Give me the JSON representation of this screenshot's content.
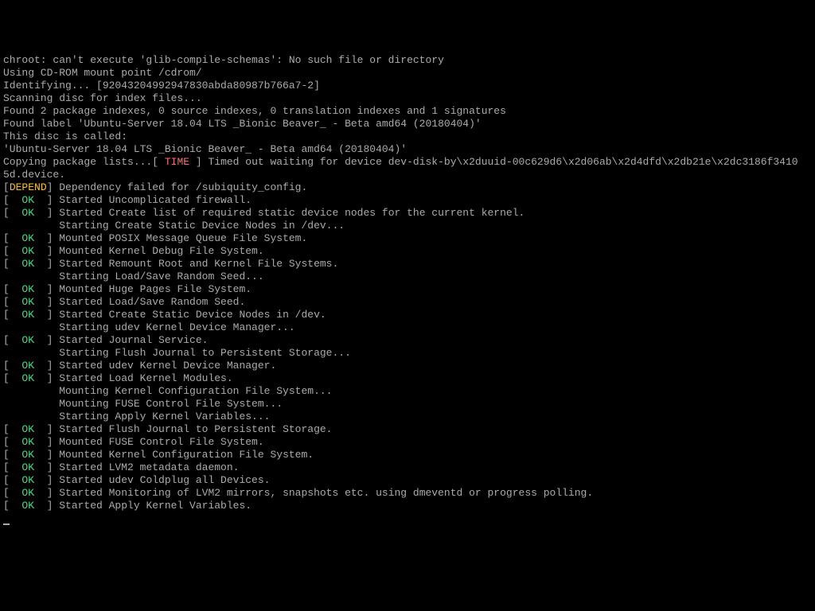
{
  "lines": [
    {
      "segments": [
        {
          "text": "chroot: can't execute 'glib-compile-schemas': No such file or directory",
          "class": "white"
        }
      ]
    },
    {
      "segments": [
        {
          "text": "Using CD-ROM mount point /cdrom/",
          "class": "white"
        }
      ]
    },
    {
      "segments": [
        {
          "text": "Identifying... [92043204992947830abda80987b766a7-2]",
          "class": "white"
        }
      ]
    },
    {
      "segments": [
        {
          "text": "Scanning disc for index files...",
          "class": "white"
        }
      ]
    },
    {
      "segments": [
        {
          "text": "Found 2 package indexes, 0 source indexes, 0 translation indexes and 1 signatures",
          "class": "white"
        }
      ]
    },
    {
      "segments": [
        {
          "text": "Found label 'Ubuntu-Server 18.04 LTS _Bionic Beaver_ - Beta amd64 (20180404)'",
          "class": "white"
        }
      ]
    },
    {
      "segments": [
        {
          "text": "This disc is called:",
          "class": "white"
        }
      ]
    },
    {
      "segments": [
        {
          "text": "'Ubuntu-Server 18.04 LTS _Bionic Beaver_ - Beta amd64 (20180404)'",
          "class": "white"
        }
      ]
    },
    {
      "segments": [
        {
          "text": "Copying package lists...[ ",
          "class": "white"
        },
        {
          "text": "TIME",
          "class": "red"
        },
        {
          "text": " ] Timed out waiting for device dev-disk-by\\x2duuid-00c629d6\\x2d06ab\\x2d4dfd\\x2db21e\\x2dc3186f3410",
          "class": "white"
        }
      ]
    },
    {
      "segments": [
        {
          "text": "5d.device.",
          "class": "white"
        }
      ]
    },
    {
      "segments": [
        {
          "text": "[",
          "class": "white"
        },
        {
          "text": "DEPEND",
          "class": "yellow"
        },
        {
          "text": "] Dependency failed for /subiquity_config.",
          "class": "white"
        }
      ]
    },
    {
      "segments": [
        {
          "text": "[  ",
          "class": "white"
        },
        {
          "text": "OK",
          "class": "green"
        },
        {
          "text": "  ] Started Uncomplicated firewall.",
          "class": "white"
        }
      ]
    },
    {
      "segments": [
        {
          "text": "[  ",
          "class": "white"
        },
        {
          "text": "OK",
          "class": "green"
        },
        {
          "text": "  ] Started Create list of required static device nodes for the current kernel.",
          "class": "white"
        }
      ]
    },
    {
      "segments": [
        {
          "text": "         Starting Create Static Device Nodes in /dev...",
          "class": "white"
        }
      ]
    },
    {
      "segments": [
        {
          "text": "[  ",
          "class": "white"
        },
        {
          "text": "OK",
          "class": "green"
        },
        {
          "text": "  ] Mounted POSIX Message Queue File System.",
          "class": "white"
        }
      ]
    },
    {
      "segments": [
        {
          "text": "[  ",
          "class": "white"
        },
        {
          "text": "OK",
          "class": "green"
        },
        {
          "text": "  ] Mounted Kernel Debug File System.",
          "class": "white"
        }
      ]
    },
    {
      "segments": [
        {
          "text": "[  ",
          "class": "white"
        },
        {
          "text": "OK",
          "class": "green"
        },
        {
          "text": "  ] Started Remount Root and Kernel File Systems.",
          "class": "white"
        }
      ]
    },
    {
      "segments": [
        {
          "text": "         Starting Load/Save Random Seed...",
          "class": "white"
        }
      ]
    },
    {
      "segments": [
        {
          "text": "[  ",
          "class": "white"
        },
        {
          "text": "OK",
          "class": "green"
        },
        {
          "text": "  ] Mounted Huge Pages File System.",
          "class": "white"
        }
      ]
    },
    {
      "segments": [
        {
          "text": "[  ",
          "class": "white"
        },
        {
          "text": "OK",
          "class": "green"
        },
        {
          "text": "  ] Started Load/Save Random Seed.",
          "class": "white"
        }
      ]
    },
    {
      "segments": [
        {
          "text": "[  ",
          "class": "white"
        },
        {
          "text": "OK",
          "class": "green"
        },
        {
          "text": "  ] Started Create Static Device Nodes in /dev.",
          "class": "white"
        }
      ]
    },
    {
      "segments": [
        {
          "text": "         Starting udev Kernel Device Manager...",
          "class": "white"
        }
      ]
    },
    {
      "segments": [
        {
          "text": "[  ",
          "class": "white"
        },
        {
          "text": "OK",
          "class": "green"
        },
        {
          "text": "  ] Started Journal Service.",
          "class": "white"
        }
      ]
    },
    {
      "segments": [
        {
          "text": "         Starting Flush Journal to Persistent Storage...",
          "class": "white"
        }
      ]
    },
    {
      "segments": [
        {
          "text": "[  ",
          "class": "white"
        },
        {
          "text": "OK",
          "class": "green"
        },
        {
          "text": "  ] Started udev Kernel Device Manager.",
          "class": "white"
        }
      ]
    },
    {
      "segments": [
        {
          "text": "[  ",
          "class": "white"
        },
        {
          "text": "OK",
          "class": "green"
        },
        {
          "text": "  ] Started Load Kernel Modules.",
          "class": "white"
        }
      ]
    },
    {
      "segments": [
        {
          "text": "         Mounting Kernel Configuration File System...",
          "class": "white"
        }
      ]
    },
    {
      "segments": [
        {
          "text": "         Mounting FUSE Control File System...",
          "class": "white"
        }
      ]
    },
    {
      "segments": [
        {
          "text": "         Starting Apply Kernel Variables...",
          "class": "white"
        }
      ]
    },
    {
      "segments": [
        {
          "text": "[  ",
          "class": "white"
        },
        {
          "text": "OK",
          "class": "green"
        },
        {
          "text": "  ] Started Flush Journal to Persistent Storage.",
          "class": "white"
        }
      ]
    },
    {
      "segments": [
        {
          "text": "[  ",
          "class": "white"
        },
        {
          "text": "OK",
          "class": "green"
        },
        {
          "text": "  ] Mounted FUSE Control File System.",
          "class": "white"
        }
      ]
    },
    {
      "segments": [
        {
          "text": "[  ",
          "class": "white"
        },
        {
          "text": "OK",
          "class": "green"
        },
        {
          "text": "  ] Mounted Kernel Configuration File System.",
          "class": "white"
        }
      ]
    },
    {
      "segments": [
        {
          "text": "[  ",
          "class": "white"
        },
        {
          "text": "OK",
          "class": "green"
        },
        {
          "text": "  ] Started LVM2 metadata daemon.",
          "class": "white"
        }
      ]
    },
    {
      "segments": [
        {
          "text": "[  ",
          "class": "white"
        },
        {
          "text": "OK",
          "class": "green"
        },
        {
          "text": "  ] Started udev Coldplug all Devices.",
          "class": "white"
        }
      ]
    },
    {
      "segments": [
        {
          "text": "[  ",
          "class": "white"
        },
        {
          "text": "OK",
          "class": "green"
        },
        {
          "text": "  ] Started Monitoring of LVM2 mirrors, snapshots etc. using dmeventd or progress polling.",
          "class": "white"
        }
      ]
    },
    {
      "segments": [
        {
          "text": "[  ",
          "class": "white"
        },
        {
          "text": "OK",
          "class": "green"
        },
        {
          "text": "  ] Started Apply Kernel Variables.",
          "class": "white"
        }
      ]
    }
  ]
}
